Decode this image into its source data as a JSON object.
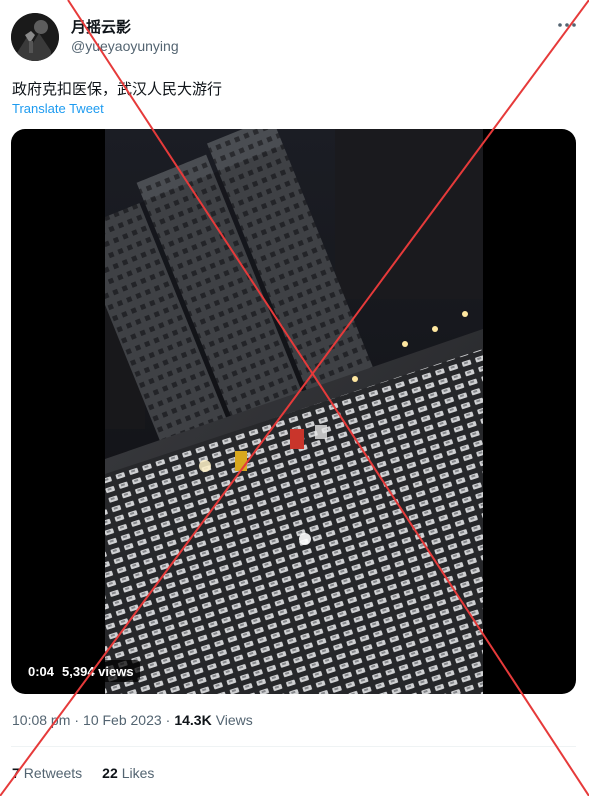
{
  "author": {
    "display_name": "月摇云影",
    "handle": "@yueyaoyunying"
  },
  "more_icon": "more-horizontal-icon",
  "tweet": {
    "text": "政府克扣医保，武汉人民大游行",
    "translate_label": "Translate Tweet"
  },
  "video": {
    "duration": "0:04",
    "views": "5,394 views"
  },
  "meta": {
    "time": "10:08 pm",
    "separator": "·",
    "date": "10 Feb 2023",
    "views_count": "14.3K",
    "views_label": "Views"
  },
  "stats": {
    "retweets_count": "7",
    "retweets_label": "Retweets",
    "likes_count": "22",
    "likes_label": "Likes"
  },
  "colors": {
    "link": "#1d9bf0",
    "secondary_text": "#536471",
    "cross_overlay": "#e63a3a"
  }
}
